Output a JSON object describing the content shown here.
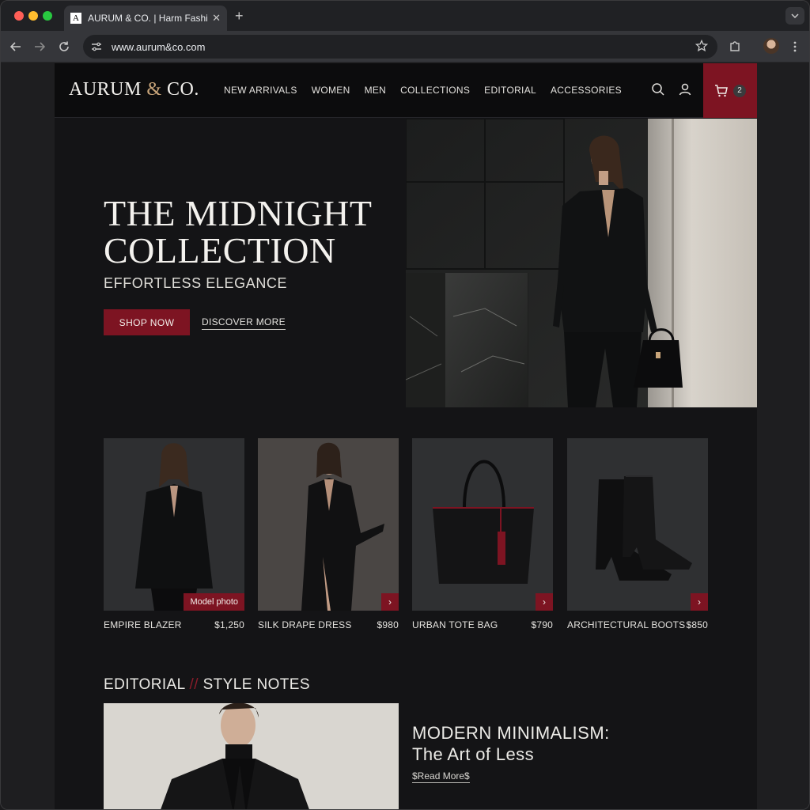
{
  "browser": {
    "tab_title": "AURUM & CO. | Harm Fashio",
    "favicon_letter": "A",
    "tab_close": "✕",
    "new_tab": "+",
    "url": "www.aurum&co.com"
  },
  "site": {
    "logo_main": "AURUM",
    "logo_amp": "&",
    "logo_suffix": "CO.",
    "nav": [
      "NEW ARRIVALS",
      "WOMEN",
      "MEN",
      "COLLECTIONS",
      "EDITORIAL",
      "ACCESSORIES"
    ],
    "cart_count": "2",
    "accent_color": "#7d1422",
    "gold_color": "#c9a57a"
  },
  "hero": {
    "title": "THE MIDNIGHT COLLECTION",
    "subtitle": "EFFORTLESS ELEGANCE",
    "primary_button": "SHOP NOW",
    "secondary_link": "DISCOVER MORE"
  },
  "products": [
    {
      "name": "EMPIRE BLAZER",
      "price": "$1,250",
      "tag": "Model photo"
    },
    {
      "name": "SILK DRAPE DRESS",
      "price": "$980"
    },
    {
      "name": "URBAN TOTE BAG",
      "price": "$790"
    },
    {
      "name": "ARCHITECTURAL BOOTS",
      "price": "$850"
    }
  ],
  "arrow_glyph": "›",
  "editorial": {
    "heading_left": "EDITORIAL",
    "heading_sep": "//",
    "heading_right": "STYLE NOTES",
    "article_title_line1": "MODERN MINIMALISM:",
    "article_title_line2": "The Art of Less",
    "read_more": "$Read More$"
  }
}
